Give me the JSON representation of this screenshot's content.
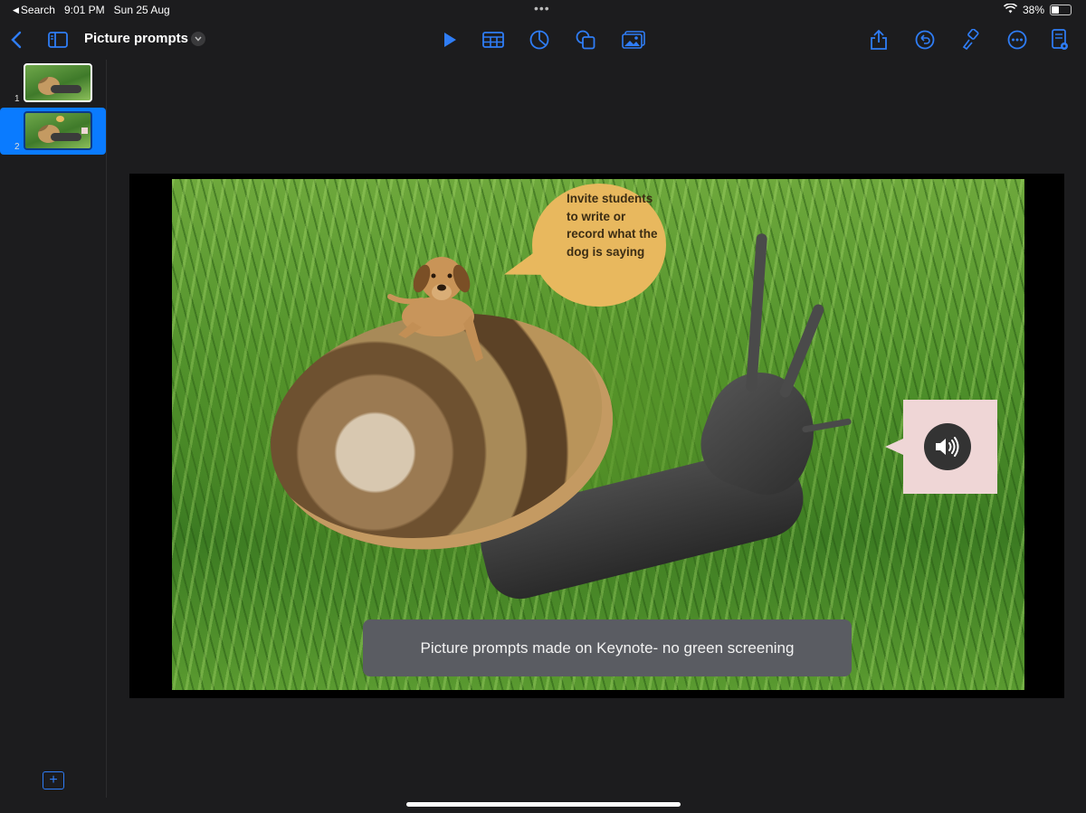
{
  "status_bar": {
    "back_app": "Search",
    "time": "9:01 PM",
    "date": "Sun 25 Aug",
    "battery": "38%",
    "battery_level": 0.38
  },
  "toolbar": {
    "title": "Picture prompts",
    "icons": [
      "back-chevron-icon",
      "sidebar-icon",
      "play-icon",
      "table-icon",
      "chart-icon",
      "shapes-icon",
      "media-icon",
      "share-icon",
      "undo-icon",
      "format-brush-icon",
      "more-icon",
      "document-icon"
    ]
  },
  "sidebar": {
    "slides": [
      {
        "number": "1",
        "selected": false
      },
      {
        "number": "2",
        "selected": true
      }
    ],
    "add_icon": "plus-icon"
  },
  "slide": {
    "bubble_text": "Invite students to write or record what the dog is saying",
    "audio_icon": "speaker-icon",
    "caption": "Picture prompts made on Keynote- no green screening"
  },
  "colors": {
    "accent": "#2f7df6",
    "selection": "#0a7bff",
    "bubble": "#e8b85e",
    "audio_box": "#efd6d6",
    "caption_bg": "#5a5c62"
  }
}
